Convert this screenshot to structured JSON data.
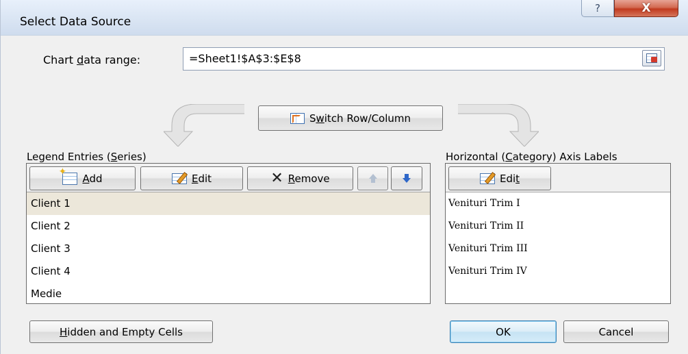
{
  "window": {
    "title": "Select Data Source",
    "help_label": "?",
    "close_label": "X"
  },
  "range": {
    "label_pre": "Chart ",
    "label_key": "d",
    "label_post": "ata range:",
    "value": "=Sheet1!$A$3:$E$8"
  },
  "switch": {
    "label_key": "w",
    "label_pre": "S",
    "label_post": "itch Row/Column"
  },
  "legend": {
    "label_pre": "Legend Entries (",
    "label_key": "S",
    "label_post": "eries)",
    "add_key": "A",
    "add_rest": "dd",
    "edit_key": "E",
    "edit_rest": "dit",
    "remove_key": "R",
    "remove_rest": "emove",
    "items": [
      "Client 1",
      "Client 2",
      "Client 3",
      "Client 4",
      "Medie"
    ],
    "selected_index": 0
  },
  "axis": {
    "label_pre": "Horizontal (",
    "label_key": "C",
    "label_post": "ategory) Axis Labels",
    "edit_pre": "Edi",
    "edit_key": "t",
    "items": [
      "Venituri Trim I",
      "Venituri Trim II",
      "Venituri Trim III",
      "Venituri Trim IV"
    ]
  },
  "footer": {
    "hidden_key": "H",
    "hidden_rest": "idden and Empty Cells",
    "ok_label": "OK",
    "cancel_label": "Cancel"
  },
  "colors": {
    "selected_row": "#ece7da",
    "close_button": "#c13a1f",
    "ok_border": "#3c7fb1"
  },
  "icons": {
    "collapse": "collapse-dialog-icon",
    "switch": "switch-row-column-icon",
    "add": "add-series-icon",
    "edit": "edit-icon",
    "remove": "remove-x-icon",
    "up": "move-up-arrow-icon",
    "down": "move-down-arrow-icon"
  }
}
